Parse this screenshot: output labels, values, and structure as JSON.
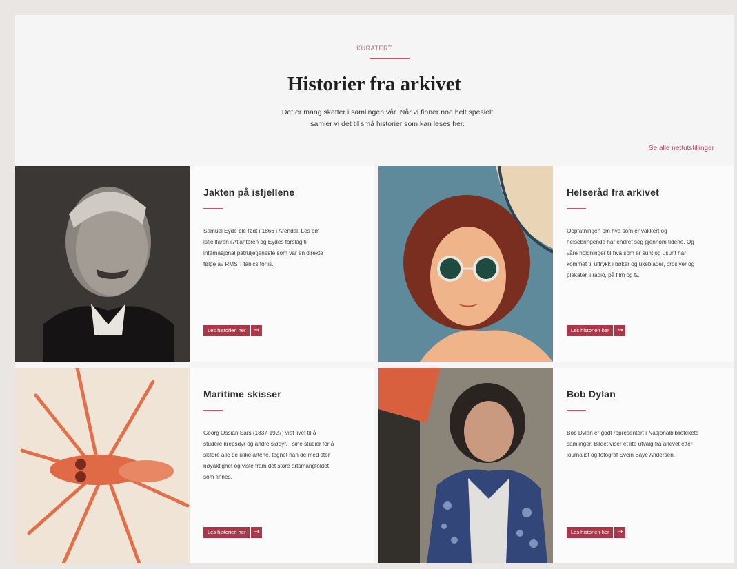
{
  "header": {
    "eyebrow": "KURATERT",
    "title": "Historier fra arkivet",
    "intro": "Det er mang skatter i samlingen vår. Når vi finner noe helt spesielt samler vi det til små historier som kan leses her.",
    "see_all": "Se alle nettutstillinger"
  },
  "cards": [
    {
      "title": "Jakten på isfjellene",
      "text": "Samuel Eyde ble født i 1866 i Arendal. Les om isfjellfaren i Atlanteren og Eydes forslag til internasjonal patruljetjeneste som var en direkte følge av RMS Titanics forlis.",
      "button": "Les historien her",
      "image_icon": "portrait-photo"
    },
    {
      "title": "Helseråd fra arkivet",
      "text": "Oppfatningen om hva som er vakkert og helsebringende har endret seg gjennom tidene. Og våre holdninger til hva som er sunt og usunt har kommet til uttrykk i bøker og ukeblader, brosjyer og plakater, i radio, på film og tv.",
      "button": "Les historien her",
      "image_icon": "sunglasses-illustration"
    },
    {
      "title": "Maritime skisser",
      "text": "Georg Ossian Sars (1837-1927) viet livet til å studere krepsdyr og andre sjødyr. I sine studier for å skildre alle de ulike artene, tegnet han de med stor nøyaktighet og viste fram det store artsmangfoldet som finnes.",
      "button": "Les historien her",
      "image_icon": "crustacean-drawing"
    },
    {
      "title": "Bob Dylan",
      "text": "Bob Dylan er godt representert i Nasjonalbibliotekets samlinger. Bildet viser et lite utvalg fra arkivet etter journalist og fotograf Svein Baye Andersen.",
      "button": "Les historien her",
      "image_icon": "dylan-photo"
    }
  ],
  "colors": {
    "accent": "#a9384b",
    "rule": "#c65a6c",
    "background": "#f6f5f5"
  }
}
